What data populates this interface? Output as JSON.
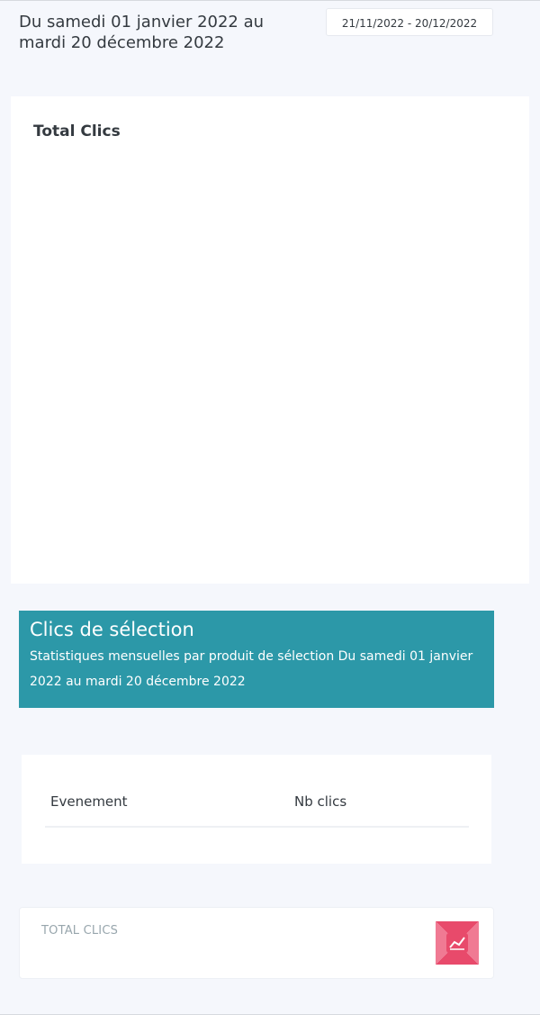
{
  "header": {
    "period_text": "Du samedi 01 janvier 2022 au mardi 20 décembre 2022",
    "date_range_value": "21/11/2022 - 20/12/2022"
  },
  "chart_card": {
    "title": "Total Clics"
  },
  "selection_banner": {
    "title": "Clics de sélection",
    "subtitle": "Statistiques mensuelles par produit de sélection Du samedi 01 janvier 2022 au mardi 20 décembre 2022",
    "background_color": "#2c98a8"
  },
  "table": {
    "columns": [
      "Evenement",
      "Nb clics"
    ],
    "rows": []
  },
  "total_card": {
    "label": "TOTAL CLICS",
    "icon": "chart-line-icon",
    "icon_color": "#e84a6b"
  }
}
